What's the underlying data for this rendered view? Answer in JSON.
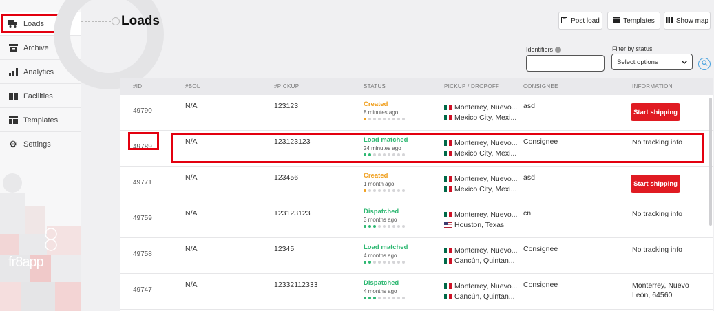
{
  "sidebar": {
    "items": [
      {
        "label": "Loads",
        "icon": "truck-icon"
      },
      {
        "label": "Archive",
        "icon": "archive-icon"
      },
      {
        "label": "Analytics",
        "icon": "bar-chart-icon"
      },
      {
        "label": "Facilities",
        "icon": "warehouse-icon"
      },
      {
        "label": "Templates",
        "icon": "template-icon"
      },
      {
        "label": "Settings",
        "icon": "gear-icon"
      }
    ],
    "brand": "fr8app"
  },
  "header": {
    "title": "Loads",
    "buttons": {
      "post_load": "Post load",
      "templates": "Templates",
      "show_map": "Show map"
    }
  },
  "filters": {
    "identifiers_label": "Identifiers",
    "status_label": "Filter by status",
    "status_value": "Select options"
  },
  "table": {
    "columns": [
      "#ID",
      "#BOL",
      "#PICKUP",
      "STATUS",
      "PICKUP / DROPOFF",
      "CONSIGNEE",
      "INFORMATION"
    ],
    "rows": [
      {
        "id": "49790",
        "bol": "N/A",
        "pickup": "123123",
        "status": "Created",
        "status_time": "8 minutes ago",
        "progress": 1,
        "origin": "Monterrey, Nuevo...",
        "origin_flag": "mx",
        "dest": "Mexico City, Mexi...",
        "dest_flag": "mx",
        "consignee": "asd",
        "info": "Start shipping",
        "info_type": "button"
      },
      {
        "id": "49789",
        "bol": "N/A",
        "pickup": "123123123",
        "status": "Load matched",
        "status_time": "24 minutes ago",
        "progress": 2,
        "origin": "Monterrey, Nuevo...",
        "origin_flag": "mx",
        "dest": "Mexico City, Mexi...",
        "dest_flag": "mx",
        "consignee": "Consignee",
        "info": "No tracking info",
        "info_type": "text"
      },
      {
        "id": "49771",
        "bol": "N/A",
        "pickup": "123456",
        "status": "Created",
        "status_time": "1 month ago",
        "progress": 1,
        "origin": "Monterrey, Nuevo...",
        "origin_flag": "mx",
        "dest": "Mexico City, Mexi...",
        "dest_flag": "mx",
        "consignee": "asd",
        "info": "Start shipping",
        "info_type": "button"
      },
      {
        "id": "49759",
        "bol": "N/A",
        "pickup": "123123123",
        "status": "Dispatched",
        "status_time": "3 months ago",
        "progress": 3,
        "origin": "Monterrey, Nuevo...",
        "origin_flag": "mx",
        "dest": "Houston, Texas",
        "dest_flag": "us",
        "consignee": "cn",
        "info": "No tracking info",
        "info_type": "text"
      },
      {
        "id": "49758",
        "bol": "N/A",
        "pickup": "12345",
        "status": "Load matched",
        "status_time": "4 months ago",
        "progress": 2,
        "origin": "Monterrey, Nuevo...",
        "origin_flag": "mx",
        "dest": "Cancún, Quintan...",
        "dest_flag": "mx",
        "consignee": "Consignee",
        "info": "No tracking info",
        "info_type": "text"
      },
      {
        "id": "49747",
        "bol": "N/A",
        "pickup": "12332112333",
        "status": "Dispatched",
        "status_time": "4 months ago",
        "progress": 3,
        "origin": "Monterrey, Nuevo...",
        "origin_flag": "mx",
        "dest": "Cancún, Quintan...",
        "dest_flag": "mx",
        "consignee": "Consignee",
        "info": "Monterrey, Nuevo León, 64560",
        "info_type": "text"
      }
    ]
  },
  "colors": {
    "status_created": "#f0a020",
    "status_matched": "#2eb872",
    "status_dispatched": "#2eb872",
    "highlight": "#e3000f",
    "start_button": "#e01b22"
  }
}
